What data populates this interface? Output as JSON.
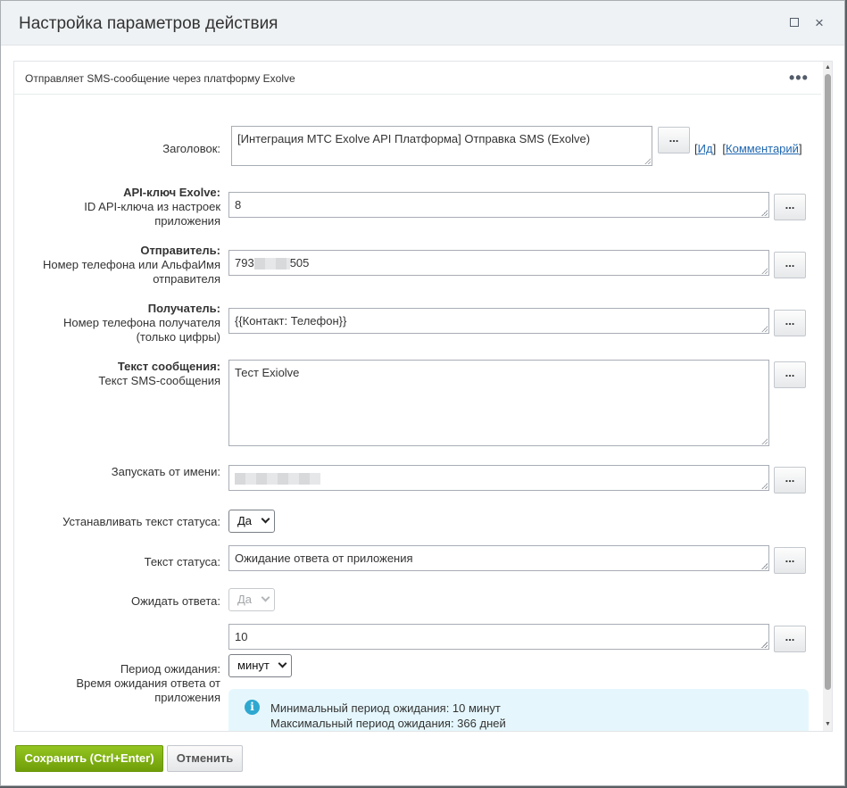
{
  "window": {
    "title": "Настройка параметров действия",
    "maximize_icon": "square-icon",
    "close_icon": "×"
  },
  "panel": {
    "description": "Отправляет SMS-сообщение через платформу Exolve",
    "menu_icon": "•••"
  },
  "fields": {
    "title": {
      "label": "Заголовок:",
      "value": "[Интеграция МТС Exolve API Платформа] Отправка SMS (Exolve)",
      "button": "...",
      "id_link": "Ид",
      "comment_link": "Комментарий",
      "bracket_open": "[",
      "bracket_close": "]"
    },
    "api_key": {
      "label_bold": "API-ключ Exolve:",
      "label_sub": "ID API-ключа из настроек приложения",
      "value": "8",
      "button": "..."
    },
    "sender": {
      "label_bold": "Отправитель:",
      "label_sub": "Номер телефона или АльфаИмя отправителя",
      "value_prefix": "793",
      "value_suffix": "505",
      "button": "..."
    },
    "recipient": {
      "label_bold": "Получатель:",
      "label_sub": "Номер телефона получателя (только цифры)",
      "value": "{{Контакт: Телефон}}",
      "button": "..."
    },
    "message": {
      "label_bold": "Текст сообщения:",
      "label_sub": "Текст SMS-сообщения",
      "value": "Тест Exiolve",
      "button": "..."
    },
    "run_as": {
      "label": "Запускать от имени:",
      "button": "..."
    },
    "set_status": {
      "label": "Устанавливать текст статуса:",
      "selected": "Да"
    },
    "status_text": {
      "label": "Текст статуса:",
      "value": "Ожидание ответа от приложения",
      "button": "..."
    },
    "wait_response": {
      "label": "Ожидать ответа:",
      "selected": "Да"
    },
    "wait_period": {
      "value": "10",
      "button": "...",
      "label_main": "Период ожидания:",
      "label_sub": "Время ожидания ответа от приложения",
      "unit_selected": "минут"
    }
  },
  "info": {
    "icon": "i",
    "min_text": "Минимальный период ожидания: 10 минут",
    "max_text": "Максимальный период ожидания: 366 дней"
  },
  "footer": {
    "save_label": "Сохранить (Ctrl+Enter)",
    "cancel_label": "Отменить"
  },
  "colors": {
    "save_button": "#7fb015",
    "link": "#2067b0",
    "info_background": "#e5f7fd",
    "info_icon": "#2fa8d0"
  }
}
